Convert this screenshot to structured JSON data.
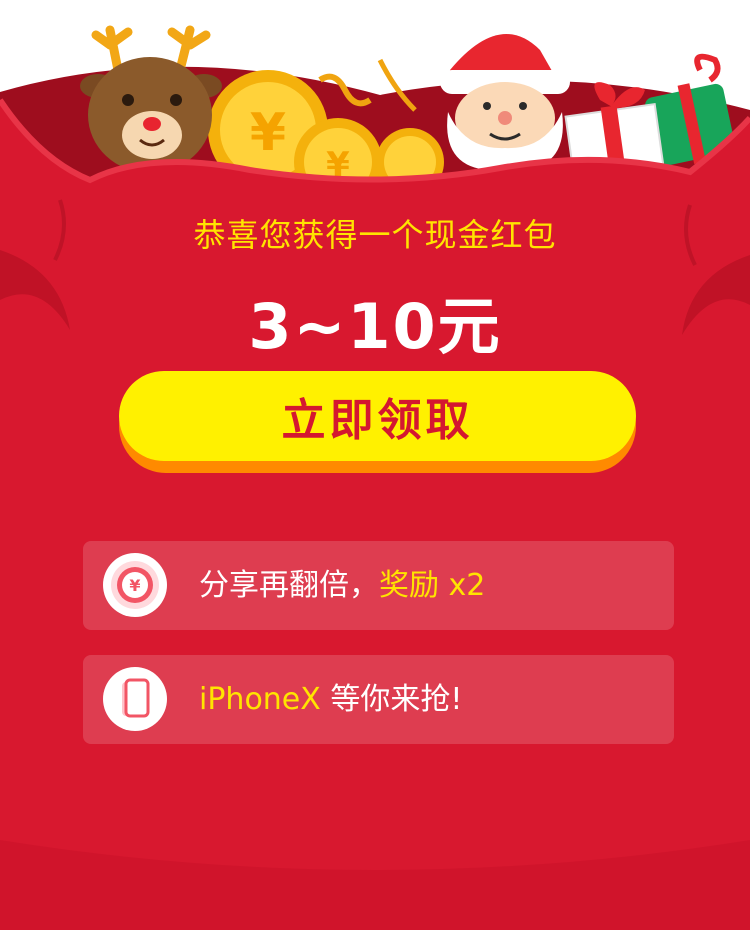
{
  "promo": {
    "headline": "恭喜您获得一个现金红包",
    "amount": "3~10元",
    "claim_button_label": "立即领取"
  },
  "perks": [
    {
      "prefix": "分享再翻倍，",
      "highlight": "奖励 x2",
      "suffix": "",
      "icon": "red-envelope-coin-icon"
    },
    {
      "prefix": "",
      "highlight": "iPhoneX",
      "suffix": " 等你来抢!",
      "icon": "phone-icon"
    }
  ],
  "illustration": {
    "coin_symbol": "¥",
    "characters": [
      "reindeer-icon",
      "santa-icon",
      "gift-box-icon",
      "gold-coins-icon"
    ]
  },
  "colors": {
    "bag_red": "#d8182f",
    "bag_dark": "#a80f20",
    "headline_yellow": "#ffe400",
    "button_yellow": "#fff100",
    "button_shadow": "#ff8a00",
    "button_text": "#d41730"
  }
}
